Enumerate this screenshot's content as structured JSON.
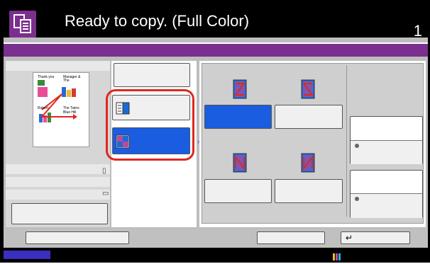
{
  "header": {
    "title": "Ready to copy. (Full Color)",
    "page_number": "1"
  },
  "icons": {
    "app": "copy-icon",
    "toner": "toner-level-icon",
    "enter": "enter-icon"
  },
  "colors": {
    "accent_purple": "#7b2f8e",
    "selected_blue": "#1a5de0",
    "highlight_red": "#e0271f"
  },
  "preview": {
    "lines": [
      "Thank you",
      "Manager & The",
      "Robert",
      "The Twins",
      "Blue Hill"
    ]
  },
  "layout_options": [
    "Z",
    "reverse Z",
    "N (top-left down)",
    "N (top-right down)"
  ],
  "footer": {
    "enter_glyph": "↵"
  }
}
